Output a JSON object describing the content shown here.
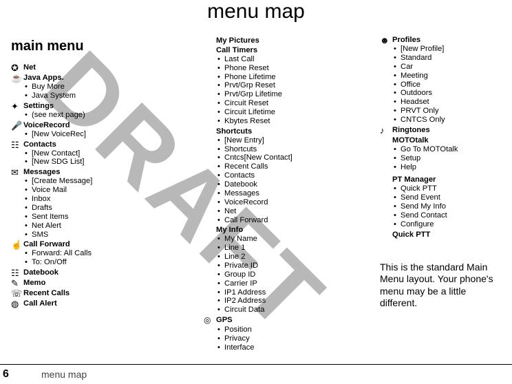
{
  "title": "menu map",
  "main_heading": "main menu",
  "watermark": "DRAFT",
  "footer": {
    "page": "6",
    "label": "menu map"
  },
  "note": "This is the standard Main Menu layout. Your phone's menu may be a little different.",
  "col1": {
    "net": {
      "title": "Net"
    },
    "java": {
      "title": "Java Apps.",
      "items": [
        "Buy More",
        "Java System"
      ]
    },
    "settings": {
      "title": "Settings",
      "items": [
        "(see next page)"
      ]
    },
    "voicerecord": {
      "title": "VoiceRecord",
      "items": [
        "[New VoiceRec]"
      ]
    },
    "contacts": {
      "title": "Contacts",
      "items": [
        "[New Contact]",
        "[New SDG List]"
      ]
    },
    "messages": {
      "title": "Messages",
      "items": [
        "[Create Message]",
        "Voice Mail",
        "Inbox",
        "Drafts",
        "Sent Items",
        "Net Alert",
        "SMS"
      ]
    },
    "callforward": {
      "title": "Call Forward",
      "items": [
        "Forward: All Calls",
        "To: On/Off"
      ]
    },
    "datebook": {
      "title": "Datebook"
    },
    "memo": {
      "title": "Memo"
    },
    "recentcalls": {
      "title": "Recent Calls"
    },
    "callalert": {
      "title": "Call Alert"
    }
  },
  "col2": {
    "mypictures": {
      "title": "My Pictures"
    },
    "calltimers": {
      "title": "Call Timers",
      "items": [
        "Last Call",
        "Phone Reset",
        "Phone Lifetime",
        "Prvt/Grp Reset",
        "Prvt/Grp Lifetime",
        "Circuit Reset",
        "Circuit Lifetime",
        "Kbytes Reset"
      ]
    },
    "shortcuts": {
      "title": "Shortcuts",
      "items": [
        "[New Entry]",
        "Shortcuts",
        "Cntcs[New Contact]",
        "Recent Calls",
        "Contacts",
        "Datebook",
        "Messages",
        "VoiceRecord",
        "Net",
        "Call Forward"
      ]
    },
    "myinfo": {
      "title": "My Info",
      "items": [
        "My Name",
        "Line 1",
        "Line 2",
        "Private ID",
        "Group ID",
        "Carrier IP",
        "IP1 Address",
        "IP2 Address",
        "Circuit Data"
      ]
    },
    "gps": {
      "title": "GPS",
      "items": [
        "Position",
        "Privacy",
        "Interface"
      ]
    }
  },
  "col3": {
    "profiles": {
      "title": "Profiles",
      "items": [
        "[New Profile]",
        "Standard",
        "Car",
        "Meeting",
        "Office",
        "Outdoors",
        "Headset",
        "PRVT Only",
        "CNTCS Only"
      ]
    },
    "ringtones": {
      "title": "Ringtones"
    },
    "mototalk": {
      "title": "MOTOtalk",
      "items": [
        "Go To MOTOtalk",
        "Setup",
        "Help"
      ]
    },
    "ptmanager": {
      "title": "PT Manager",
      "items": [
        "Quick PTT",
        "Send Event",
        "Send My Info",
        "Send Contact",
        "Configure"
      ]
    },
    "quickptt": {
      "title": "Quick PTT"
    }
  }
}
